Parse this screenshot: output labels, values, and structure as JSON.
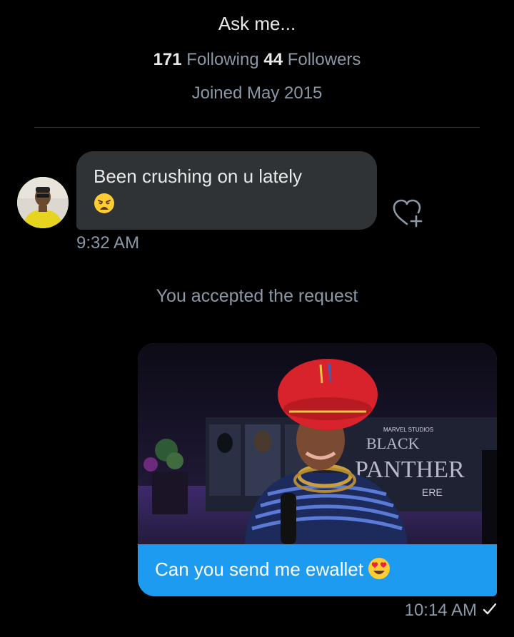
{
  "profile": {
    "bio": "Ask me...",
    "following_count": "171",
    "following_label": "Following",
    "followers_count": "44",
    "followers_label": "Followers",
    "joined": "Joined May 2015"
  },
  "conversation": {
    "incoming": {
      "text": "Been crushing on u lately",
      "emoji": "weary-face",
      "time": "9:32 AM",
      "react_icon": "heart-plus-icon"
    },
    "system_message": "You accepted the request",
    "outgoing": {
      "media_text": {
        "studio": "MARVEL STUDIOS",
        "title_line1": "BLACK",
        "title_line2": "PANTHER",
        "sign_fragment": "ERE"
      },
      "text": "Can you send me ewallet",
      "emoji": "heart-eyes",
      "time": "10:14 AM",
      "status_icon": "check-icon"
    }
  },
  "colors": {
    "background": "#000000",
    "incoming_bubble": "#2f3336",
    "outgoing_bubble": "#1d9bf0",
    "secondary_text": "#8b98a5",
    "primary_text": "#e7e9ea"
  }
}
